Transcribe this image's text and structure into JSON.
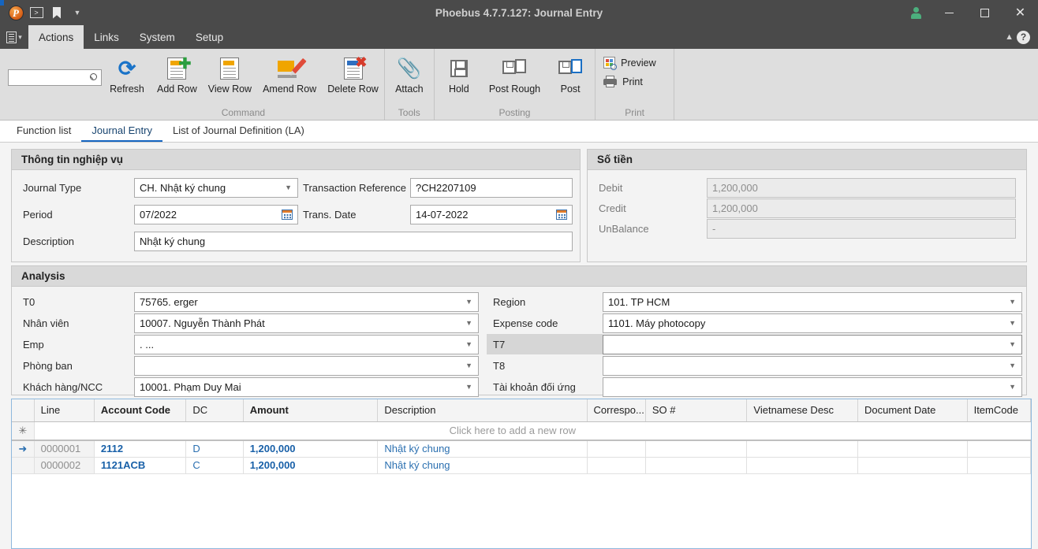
{
  "window": {
    "title": "Phoebus 4.7.7.127: Journal Entry",
    "quick_access": {
      "logo": "phoebus-logo",
      "console_icon": ">",
      "bookmark_icon": "bookmark-icon",
      "overflow_icon": "chevron-down-icon"
    },
    "controls": {
      "user_icon": "user-icon",
      "minimize": "minimize-icon",
      "maximize": "maximize-icon",
      "close": "close-icon"
    }
  },
  "menubar": {
    "app_button_icon": "document-menu-icon",
    "items": [
      {
        "label": "Actions",
        "active": true
      },
      {
        "label": "Links",
        "active": false
      },
      {
        "label": "System",
        "active": false
      },
      {
        "label": "Setup",
        "active": false
      }
    ],
    "collapse_icon": "chevron-up-icon",
    "help_icon": "help-icon"
  },
  "search": {
    "value": "",
    "placeholder": "",
    "icon": "search-icon"
  },
  "ribbon": {
    "groups": [
      {
        "title": "Command",
        "buttons": [
          {
            "label": "Refresh",
            "icon": "refresh-icon"
          },
          {
            "label": "Add Row",
            "icon": "add-row-icon"
          },
          {
            "label": "View Row",
            "icon": "view-row-icon"
          },
          {
            "label": "Amend Row",
            "icon": "amend-row-icon"
          },
          {
            "label": "Delete Row",
            "icon": "delete-row-icon"
          }
        ]
      },
      {
        "title": "Tools",
        "buttons": [
          {
            "label": "Attach",
            "icon": "attach-icon"
          }
        ]
      },
      {
        "title": "Posting",
        "buttons": [
          {
            "label": "Hold",
            "icon": "hold-icon"
          },
          {
            "label": "Post Rough",
            "icon": "post-rough-icon"
          },
          {
            "label": "Post",
            "icon": "post-icon"
          }
        ]
      },
      {
        "title": "Print",
        "buttons": [
          {
            "label": "Preview",
            "icon": "preview-icon"
          },
          {
            "label": "Print",
            "icon": "print-icon"
          }
        ]
      }
    ]
  },
  "tabs": [
    {
      "label": "Function list",
      "active": false
    },
    {
      "label": "Journal Entry",
      "active": true
    },
    {
      "label": "List of Journal Definition (LA)",
      "active": false
    }
  ],
  "business_info": {
    "title": "Thông tin nghiệp vụ",
    "journal_type": {
      "label": "Journal Type",
      "value": "CH. Nhật ký chung"
    },
    "transaction_reference": {
      "label": "Transaction Reference",
      "value": "?CH2207109"
    },
    "period": {
      "label": "Period",
      "value": "07/2022"
    },
    "trans_date": {
      "label": "Trans. Date",
      "value": "14-07-2022"
    },
    "description": {
      "label": "Description",
      "value": "Nhật ký chung"
    }
  },
  "amount": {
    "title": "Số tiền",
    "debit": {
      "label": "Debit",
      "value": "1,200,000"
    },
    "credit": {
      "label": "Credit",
      "value": "1,200,000"
    },
    "unbalance": {
      "label": "UnBalance",
      "value": "-"
    }
  },
  "analysis": {
    "title": "Analysis",
    "left": [
      {
        "label": "T0",
        "value": "75765. erger"
      },
      {
        "label": "Nhân viên",
        "value": "10007. Nguyễn Thành Phát"
      },
      {
        "label": "Emp",
        "value": ". ..."
      },
      {
        "label": "Phòng ban",
        "value": ""
      },
      {
        "label": "Khách hàng/NCC",
        "value": "10001. Phạm Duy Mai"
      }
    ],
    "right": [
      {
        "label": "Region",
        "value": "101. TP HCM",
        "focused": false
      },
      {
        "label": "Expense code",
        "value": "1101. Máy photocopy",
        "focused": false
      },
      {
        "label": "T7",
        "value": "",
        "focused": true
      },
      {
        "label": "T8",
        "value": "",
        "focused": false
      },
      {
        "label": "Tài khoản đối ứng",
        "value": "",
        "focused": false
      }
    ]
  },
  "grid": {
    "columns": [
      {
        "label": "",
        "bold": false
      },
      {
        "label": "Line",
        "bold": false
      },
      {
        "label": "Account Code",
        "bold": true
      },
      {
        "label": "DC",
        "bold": false
      },
      {
        "label": "Amount",
        "bold": true
      },
      {
        "label": "Description",
        "bold": false
      },
      {
        "label": "Correspo...",
        "bold": false
      },
      {
        "label": "SO #",
        "bold": false
      },
      {
        "label": "Vietnamese Desc",
        "bold": false
      },
      {
        "label": "Document Date",
        "bold": false
      },
      {
        "label": "ItemCode",
        "bold": false
      }
    ],
    "new_row_hint": "Click here to add a new row",
    "new_row_icon": "asterisk-icon",
    "current_row_icon": "arrow-right-icon",
    "rows": [
      {
        "selected": true,
        "line": "0000001",
        "account_code": "2112",
        "dc": "D",
        "amount": "1,200,000",
        "description": "Nhật ký chung",
        "corresponding": "",
        "so": "",
        "vietnamese_desc": "",
        "document_date": "",
        "item_code": ""
      },
      {
        "selected": false,
        "line": "0000002",
        "account_code": "1121ACB",
        "dc": "C",
        "amount": "1,200,000",
        "description": "Nhật ký chung",
        "corresponding": "",
        "so": "",
        "vietnamese_desc": "",
        "document_date": "",
        "item_code": ""
      }
    ]
  },
  "colors": {
    "titlebar": "#4a4a4a",
    "accent": "#1565c0",
    "ribbon": "#dedede",
    "panel_header": "#d9d9d9",
    "link_blue": "#1860a8"
  }
}
